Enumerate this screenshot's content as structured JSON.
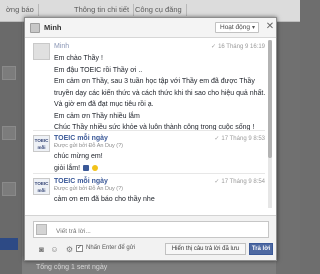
{
  "background": {
    "tabs": [
      "ờng báo",
      "Thông tin chi tiết",
      "Công cụ đăng"
    ],
    "bottom_text": "Tổng cộng 1 sent ngày"
  },
  "modal": {
    "title": "Minh",
    "status_label": "Hoạt động",
    "status_caret": "▾",
    "close_glyph": "✕"
  },
  "messages": [
    {
      "sender": "Minh",
      "time": "16 Tháng 9 16:19",
      "lines": [
        "Em chào Thầy !",
        "Em đậu TOEIC rồi Thầy ơi ..",
        "Em cảm ơn Thầy, sau 3 tuần học tập với Thầy em đã được Thầy",
        "truyền dạy các kiến thức và cách thức khi thi sao cho hiệu quả nhất.",
        "Và giờ em đã đạt mục tiêu rồi ạ.",
        "Em cảm ơn Thầy nhiều lắm",
        "Chúc Thầy nhiều sức khỏe và luôn thành công trong cuộc sống !"
      ]
    },
    {
      "sender": "TOEIC mỗi ngày",
      "time": "17 Tháng 9 8:53",
      "via": "Được gửi bởi Đỗ An Duy (?)",
      "avatar_text": "TOEIC mỗi ngày",
      "lines": [
        "chúc mừng em!",
        "giỏi lắm!"
      ]
    },
    {
      "sender": "TOEIC mỗi ngày",
      "time": "17 Tháng 9 8:54",
      "via": "Được gửi bởi Đỗ An Duy (?)",
      "avatar_text": "TOEIC mỗi ngày",
      "lines": [
        "cảm ơn em đã báo cho thầy nhe"
      ]
    }
  ],
  "composer": {
    "placeholder": "Viết trả lời...",
    "enter_label": "Nhấn Enter để gửi",
    "enter_checked": "✓",
    "quick_reply_label": "Hiển thị câu trả lời đã lưu",
    "reply_label": "Trả lời",
    "icons": [
      "camera-icon",
      "sticker-icon",
      "settings-icon"
    ]
  },
  "check_glyph": "✓"
}
